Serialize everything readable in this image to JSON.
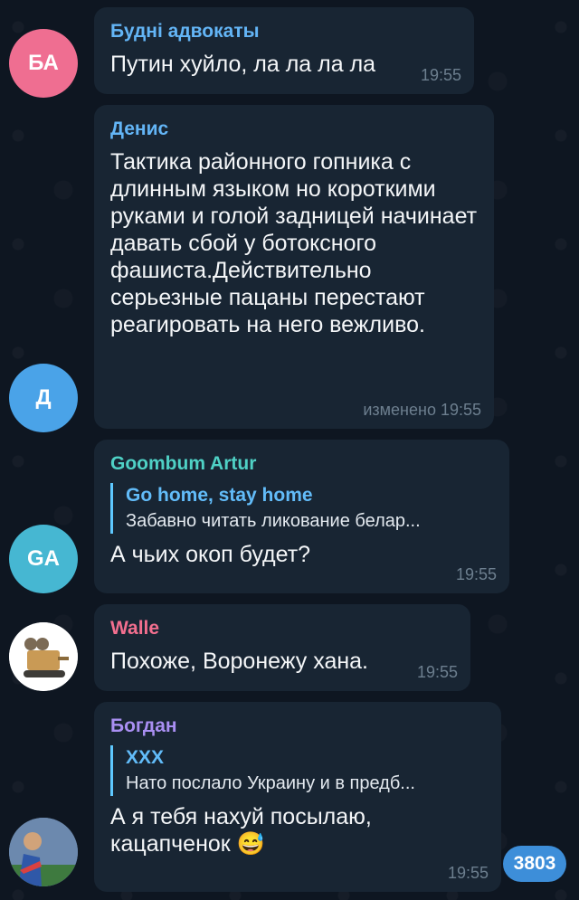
{
  "messages": [
    {
      "avatar_text": "БА",
      "sender": "Будні адвокаты",
      "text": "Путин хуйло, ла ла ла ла",
      "time": "19:55"
    },
    {
      "avatar_text": "Д",
      "sender": "Денис",
      "text": "Тактика районного гопника с длинным языком но короткими руками и голой задницей начинает давать сбой у ботоксного фашиста.Действительно серьезные пацаны перестают реагировать на него вежливо.",
      "time": "изменено 19:55"
    },
    {
      "avatar_text": "GA",
      "sender": "Goombum Artur",
      "reply_name": "Go home, stay home",
      "reply_text": "Забавно читать ликование белар...",
      "text": "А чьих окоп будет?",
      "time": "19:55"
    },
    {
      "sender": "Walle",
      "text": "Похоже, Воронежу хана.",
      "time": "19:55",
      "avatar_icon": "walle-avatar-icon"
    },
    {
      "sender": "Богдан",
      "reply_name": "XXX",
      "reply_text": "Нато послало Украину и в предб...",
      "text": "А я тебя нахуй посылаю, кацапченок",
      "emoji": "😅",
      "time": "19:55",
      "avatar_icon": "bogdan-avatar-icon"
    }
  ],
  "unread_count": "3803",
  "colors": {
    "background": "#0e1621",
    "bubble": "#182533",
    "accent": "#3d8ed9"
  }
}
